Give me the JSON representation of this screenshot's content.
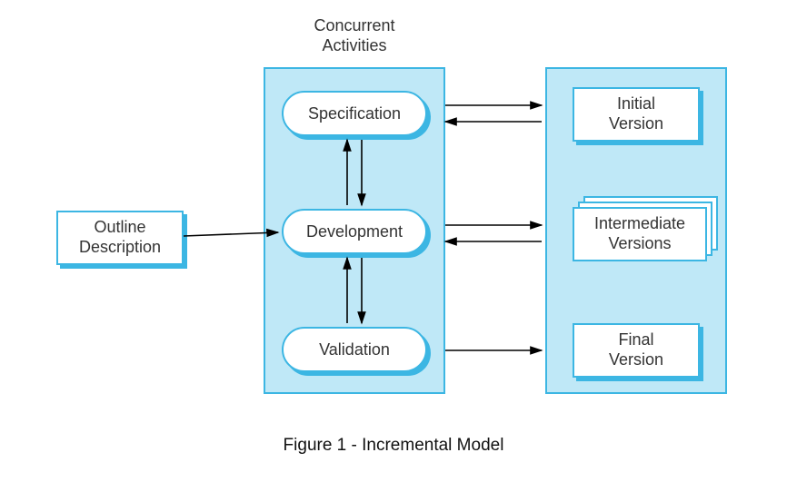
{
  "title": "Concurrent\nActivities",
  "outline": "Outline\nDescription",
  "activities": {
    "spec": "Specification",
    "dev": "Development",
    "val": "Validation"
  },
  "versions": {
    "initial": "Initial\nVersion",
    "intermediate": "Intermediate\nVersions",
    "final": "Final\nVersion"
  },
  "caption": "Figure 1 - Incremental Model",
  "colors": {
    "cyan": "#3cb6e3",
    "panel": "#bfe8f7"
  },
  "chart_data": {
    "type": "diagram",
    "title": "Incremental Model",
    "nodes": [
      {
        "id": "outline",
        "label": "Outline Description",
        "kind": "input"
      },
      {
        "id": "spec",
        "label": "Specification",
        "kind": "activity",
        "group": "Concurrent Activities"
      },
      {
        "id": "dev",
        "label": "Development",
        "kind": "activity",
        "group": "Concurrent Activities"
      },
      {
        "id": "val",
        "label": "Validation",
        "kind": "activity",
        "group": "Concurrent Activities"
      },
      {
        "id": "initial",
        "label": "Initial Version",
        "kind": "output"
      },
      {
        "id": "intermediate",
        "label": "Intermediate Versions",
        "kind": "output",
        "stacked": true
      },
      {
        "id": "final",
        "label": "Final Version",
        "kind": "output"
      }
    ],
    "edges": [
      {
        "from": "outline",
        "to": "dev",
        "bidirectional": false
      },
      {
        "from": "spec",
        "to": "dev",
        "bidirectional": true
      },
      {
        "from": "dev",
        "to": "val",
        "bidirectional": true
      },
      {
        "from": "spec",
        "to": "initial",
        "bidirectional": true
      },
      {
        "from": "dev",
        "to": "intermediate",
        "bidirectional": true
      },
      {
        "from": "val",
        "to": "final",
        "bidirectional": false
      }
    ],
    "groups": [
      {
        "id": "concurrent",
        "label": "Concurrent Activities",
        "members": [
          "spec",
          "dev",
          "val"
        ]
      },
      {
        "id": "outputs",
        "label": "",
        "members": [
          "initial",
          "intermediate",
          "final"
        ]
      }
    ]
  }
}
